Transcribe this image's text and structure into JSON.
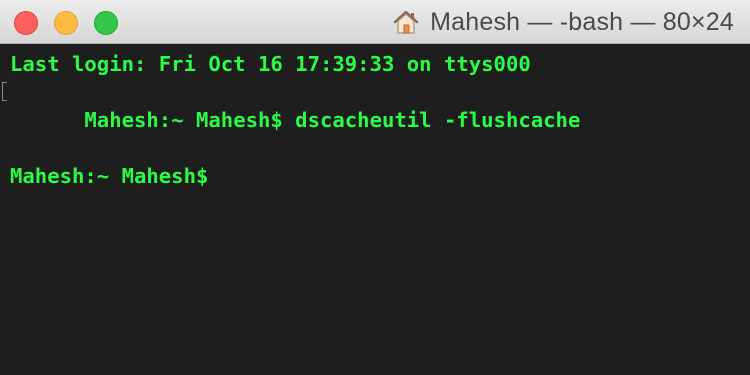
{
  "window": {
    "title": "Mahesh — -bash — 80×24",
    "title_icon": "home-icon",
    "buttons": {
      "close": "close-button",
      "minimize": "minimize-button",
      "zoom": "zoom-button"
    }
  },
  "terminal": {
    "lines": [
      "Last login: Fri Oct 16 17:39:33 on ttys000",
      "Mahesh:~ Mahesh$ dscacheutil -flushcache",
      "Mahesh:~ Mahesh$ "
    ],
    "text_color": "#2bfb47",
    "background": "#1e1e1e"
  }
}
